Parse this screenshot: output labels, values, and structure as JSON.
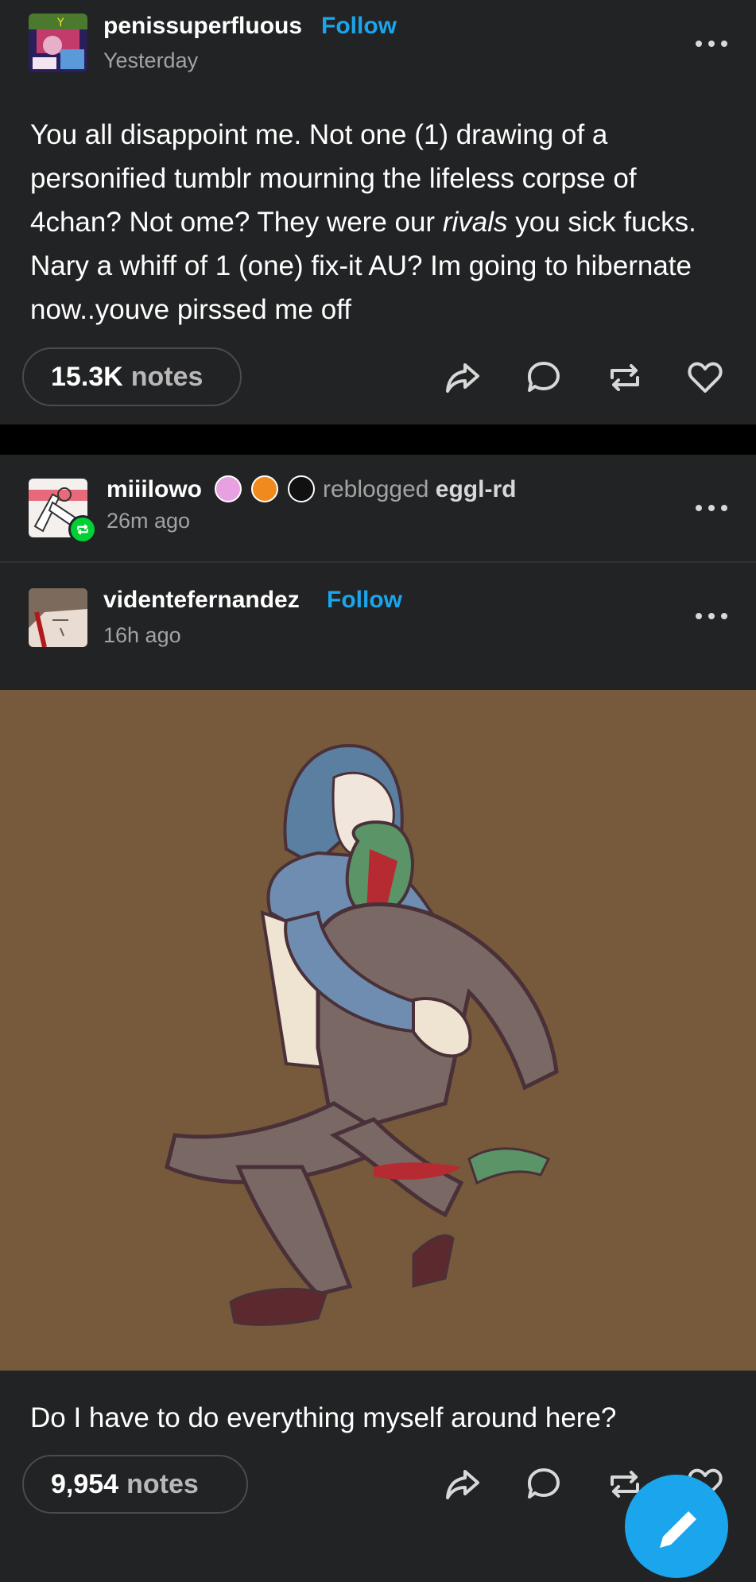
{
  "post1": {
    "username": "penissuperfluous",
    "follow_label": "Follow",
    "timestamp": "Yesterday",
    "text_before_italic": "You all disappoint me. Not one (1) drawing of a personified tumblr mourning the lifeless corpse of 4chan? Not ome? They were our ",
    "text_italic": "rivals",
    "text_after_italic": " you sick fucks. Nary a whiff of 1 (one) fix-it AU? Im going to hibernate now..youve pirssed me off",
    "notes_count": "15.3K",
    "notes_label": "notes"
  },
  "reblog": {
    "username": "miiilowo",
    "action": "reblogged",
    "source": "eggl-rd",
    "timestamp": "26m ago"
  },
  "post2": {
    "username": "videntefernandez",
    "follow_label": "Follow",
    "timestamp": "16h ago",
    "text": "Do I have to do everything myself around here?",
    "notes_count": "9,954",
    "notes_label": "notes"
  },
  "icons": {
    "more": "more-horizontal-icon",
    "share": "share-icon",
    "reply": "reply-icon",
    "reblog": "reblog-icon",
    "like": "heart-icon",
    "compose": "pencil-icon"
  },
  "colors": {
    "background": "#222324",
    "follow": "#1aa5ec",
    "reblog_badge": "#00cf35",
    "artwork_bg": "#765a3b"
  }
}
